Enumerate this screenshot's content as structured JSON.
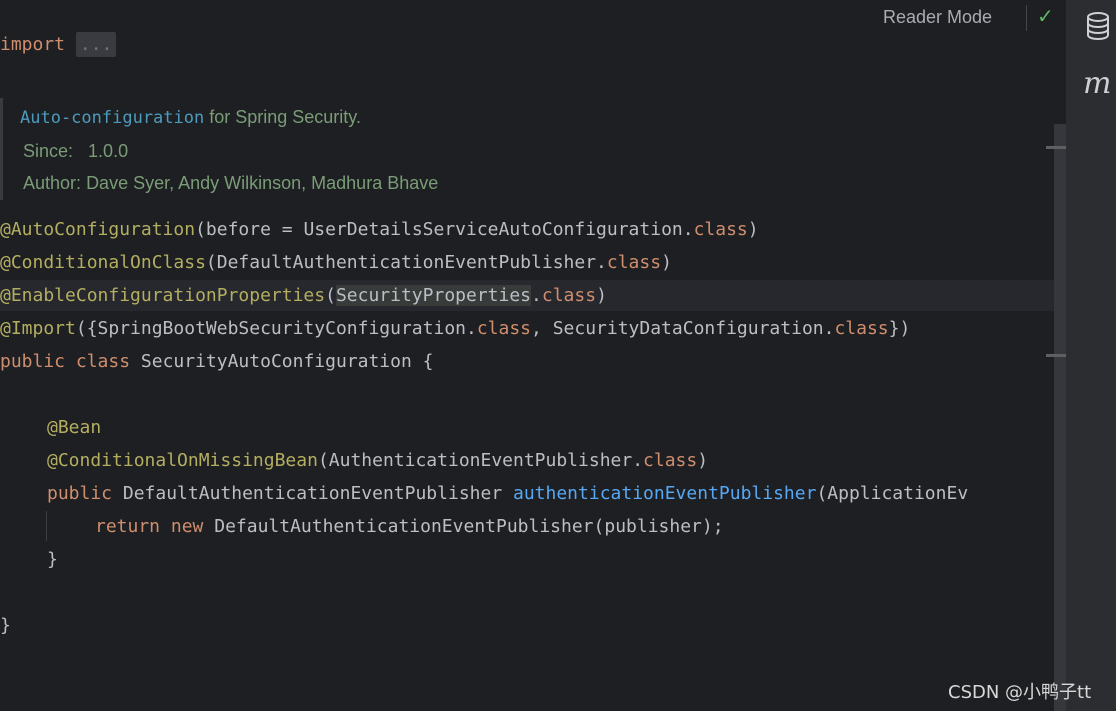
{
  "toolbar": {
    "reader_mode_label": "Reader Mode",
    "check_icon": "check-icon"
  },
  "doc": {
    "link": "Auto-configuration",
    "text": " for Spring Security.",
    "since_label": "Since:",
    "since_value": "1.0.0",
    "author_label": "Author:",
    "author_value": "Dave Syer, Andy Wilkinson, Madhura Bhave"
  },
  "code": {
    "l1_import": "import",
    "l1_fold": "...",
    "l2_ann": "@AutoConfiguration",
    "l2_a": "(before = UserDetailsServiceAutoConfiguration.",
    "l2_kw": "class",
    "l2_b": ")",
    "l3_ann": "@ConditionalOnClass",
    "l3_a": "(DefaultAuthenticationEventPublisher.",
    "l3_kw": "class",
    "l3_b": ")",
    "l4_ann": "@EnableConfigurationProperties",
    "l4_a": "(",
    "l4_word": "SecurityProperties",
    "l4_b": ".",
    "l4_kw": "class",
    "l4_c": ")",
    "l5_ann": "@Import",
    "l5_a": "({SpringBootWebSecurityConfiguration.",
    "l5_kw1": "class",
    "l5_b": ", SecurityDataConfiguration.",
    "l5_kw2": "class",
    "l5_c": "})",
    "l6_kw1": "public",
    "l6_kw2": "class",
    "l6_a": " SecurityAutoConfiguration {",
    "l7_ann": "@Bean",
    "l8_ann": "@ConditionalOnMissingBean",
    "l8_a": "(AuthenticationEventPublisher.",
    "l8_kw": "class",
    "l8_b": ")",
    "l9_kw": "public",
    "l9_a": " DefaultAuthenticationEventPublisher ",
    "l9_fn": "authenticationEventPublisher",
    "l9_b": "(ApplicationEv",
    "l10_kw1": "return",
    "l10_kw2": "new",
    "l10_a": " DefaultAuthenticationEventPublisher(publisher);",
    "l11": "}",
    "l12": "}"
  },
  "sidebar": {
    "database_icon": "database-icon",
    "maven_label": "m"
  },
  "watermark": "CSDN @小鸭子tt"
}
